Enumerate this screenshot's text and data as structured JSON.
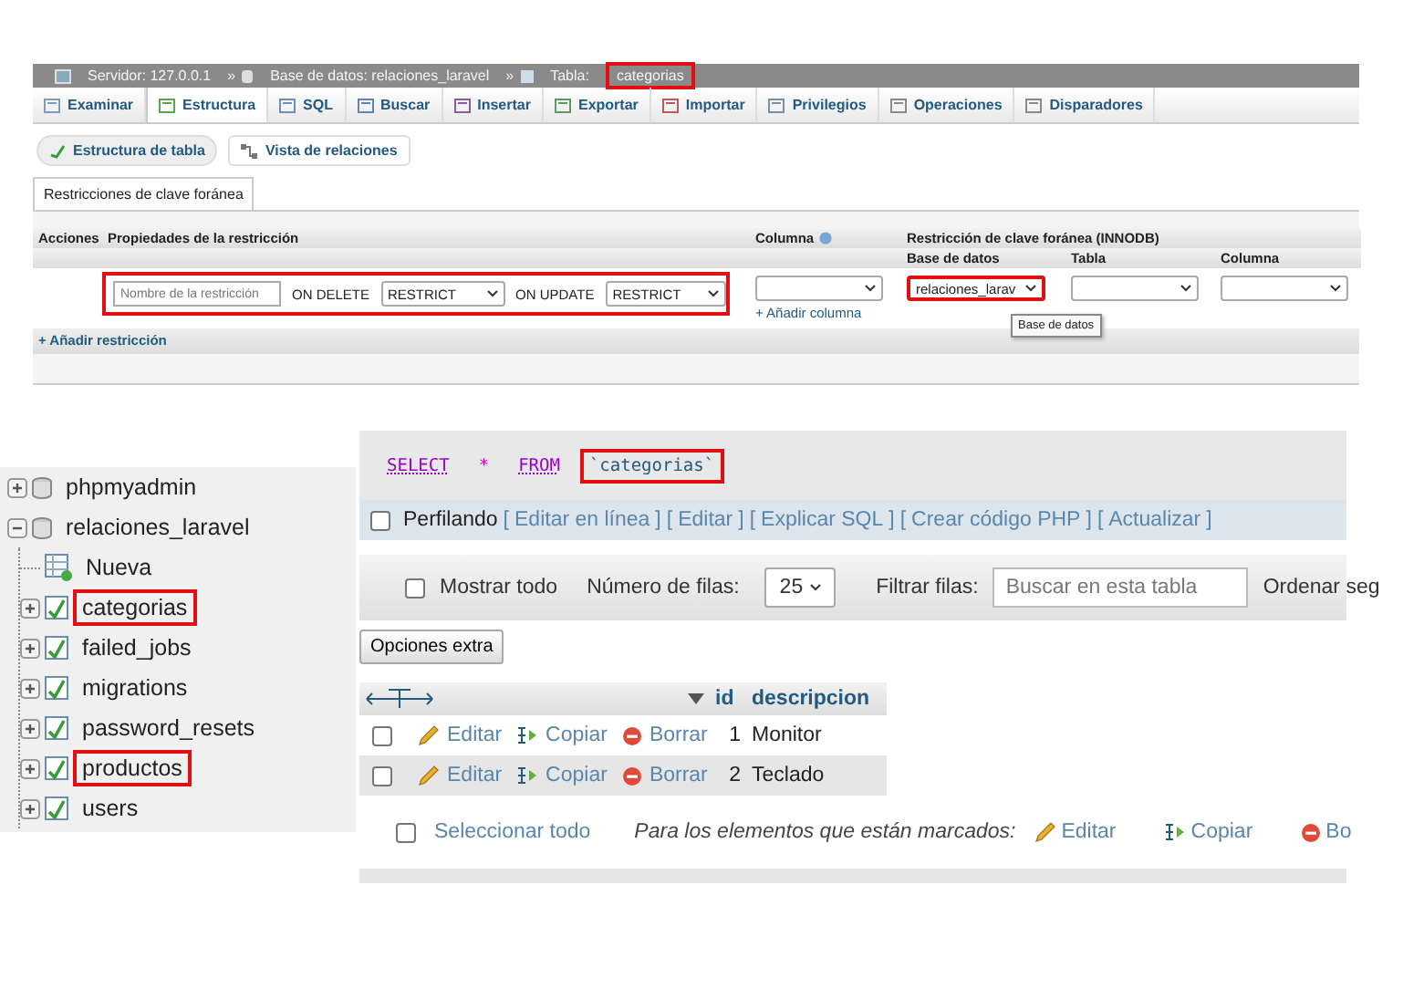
{
  "breadcrumb": {
    "separator": "»",
    "items": [
      {
        "kind": "server",
        "label": "Servidor: 127.0.0.1",
        "highlighted": false
      },
      {
        "kind": "database",
        "label": "Base de datos: relaciones_laravel",
        "highlighted": false
      },
      {
        "kind": "table",
        "label": "Tabla:",
        "highlighted": false
      },
      {
        "kind": "name",
        "label": "categorias",
        "highlighted": true
      }
    ]
  },
  "tabs": [
    {
      "label": "Examinar",
      "selected": false
    },
    {
      "label": "Estructura",
      "selected": true
    },
    {
      "label": "SQL",
      "selected": false
    },
    {
      "label": "Buscar",
      "selected": false
    },
    {
      "label": "Insertar",
      "selected": false
    },
    {
      "label": "Exportar",
      "selected": false
    },
    {
      "label": "Importar",
      "selected": false
    },
    {
      "label": "Privilegios",
      "selected": false
    },
    {
      "label": "Operaciones",
      "selected": false
    },
    {
      "label": "Disparadores",
      "selected": false
    }
  ],
  "subtabs": [
    {
      "label": "Estructura de tabla",
      "selected": true
    },
    {
      "label": "Vista de relaciones",
      "selected": false
    }
  ],
  "section_tab": "Restricciones de clave foránea",
  "constraints": {
    "headers": {
      "actions": "Acciones",
      "properties": "Propiedades de la restricción",
      "column": "Columna",
      "foreign": "Restricción de clave foránea (INNODB)"
    },
    "subheaders": [
      "Base de datos",
      "Tabla",
      "Columna"
    ],
    "name_placeholder": "Nombre de la restricción",
    "properties_highlighted": true,
    "on_delete": {
      "label": "ON DELETE",
      "value": "RESTRICT"
    },
    "on_update": {
      "label": "ON UPDATE",
      "value": "RESTRICT"
    },
    "add_column": "+ Añadir columna",
    "database_select": {
      "value": "relaciones_larav",
      "highlighted": true,
      "tooltip": "Base de datos"
    },
    "add_constraint": "+ Añadir restricción"
  },
  "tree": [
    {
      "kind": "database",
      "label": "phpmyadmin",
      "expanded": false,
      "highlighted": false
    },
    {
      "kind": "database",
      "label": "relaciones_laravel",
      "expanded": true,
      "highlighted": false,
      "children": [
        {
          "kind": "new",
          "label": "Nueva",
          "highlighted": false
        },
        {
          "kind": "table",
          "label": "categorias",
          "expanded": false,
          "highlighted": true
        },
        {
          "kind": "table",
          "label": "failed_jobs",
          "expanded": false,
          "highlighted": false
        },
        {
          "kind": "table",
          "label": "migrations",
          "expanded": false,
          "highlighted": false
        },
        {
          "kind": "table",
          "label": "password_resets",
          "expanded": false,
          "highlighted": false
        },
        {
          "kind": "table",
          "label": "productos",
          "expanded": false,
          "highlighted": true
        },
        {
          "kind": "table",
          "label": "users",
          "expanded": false,
          "highlighted": false
        }
      ]
    }
  ],
  "sql": {
    "tokens": [
      {
        "kind": "keyword",
        "text": "SELECT",
        "highlighted": false
      },
      {
        "kind": "operator",
        "text": "*",
        "highlighted": false
      },
      {
        "kind": "keyword",
        "text": "FROM",
        "highlighted": false
      },
      {
        "kind": "identifier",
        "text": "`categorias`",
        "highlighted": true
      }
    ]
  },
  "profiling": {
    "label": "Perfilando",
    "checked": false,
    "open": "[",
    "close": "]",
    "links": [
      "Editar en línea",
      "Editar",
      "Explicar SQL",
      "Crear código PHP",
      "Actualizar"
    ]
  },
  "toolbar": {
    "show_all": {
      "label": "Mostrar todo",
      "checked": false
    },
    "rows_label": "Número de filas:",
    "rows_value": "25",
    "filter_label": "Filtrar filas:",
    "filter_placeholder": "Buscar en esta tabla",
    "sort_label": "Ordenar seg"
  },
  "extra_button": "Opciones extra",
  "results": {
    "columns": [
      "id",
      "descripcion"
    ],
    "rows": [
      {
        "edit": "Editar",
        "copy": "Copiar",
        "delete": "Borrar",
        "id": "1",
        "descripcion": "Monitor",
        "checked": false
      },
      {
        "edit": "Editar",
        "copy": "Copiar",
        "delete": "Borrar",
        "id": "2",
        "descripcion": "Teclado",
        "checked": false
      }
    ]
  },
  "footer": {
    "select_all": "Seleccionar todo",
    "checked": false,
    "marked": "Para los elementos que están marcados:",
    "edit": "Editar",
    "copy": "Copiar",
    "delete": "Bo"
  }
}
